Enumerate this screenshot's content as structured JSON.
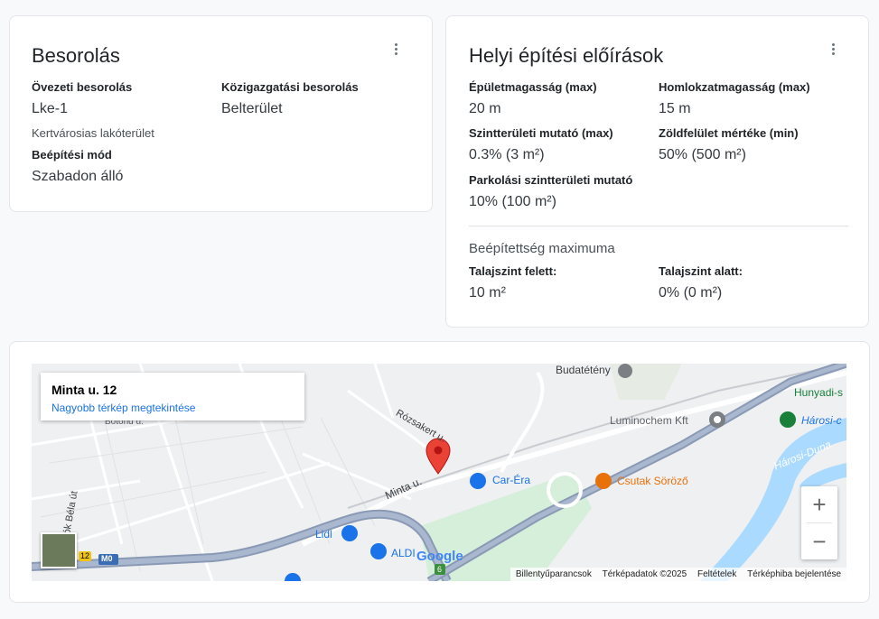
{
  "classification": {
    "title": "Besorolás",
    "zoning_label": "Övezeti besorolás",
    "zoning_value": "Lke-1",
    "zoning_desc": "Kertvárosias lakóterület",
    "admin_label": "Közigazgatási besorolás",
    "admin_value": "Belterület",
    "building_mode_label": "Beépítési mód",
    "building_mode_value": "Szabadon álló"
  },
  "regulations": {
    "title": "Helyi építési előírások",
    "building_height_label": "Épületmagasság (max)",
    "building_height_value": "20 m",
    "facade_height_label": "Homlokzatmagasság (max)",
    "facade_height_value": "15 m",
    "floor_ratio_label": "Szintterületi mutató (max)",
    "floor_ratio_value": "0.3% (3 m²)",
    "green_label": "Zöldfelület mértéke (min)",
    "green_value": "50% (500 m²)",
    "parking_label": "Parkolási szintterületi mutató",
    "parking_value": "10% (100 m²)",
    "coverage_title": "Beépítettség maximuma",
    "above_label": "Talajszint felett:",
    "above_value": "10 m²",
    "below_label": "Talajszint alatt:",
    "below_value": "0% (0 m²)"
  },
  "map": {
    "info_title": "Minta u. 12",
    "info_link": "Nagyobb térkép megtekintése",
    "labels": {
      "budatetenyi": "Budatétény",
      "hunyadi": "Hunyadi-s",
      "luminochem": "Luminochem Kft",
      "harosi_c": "Hárosi-c",
      "harosi_duna": "Hárosi-Duna",
      "rozsakert": "Rózsakert u.",
      "minta": "Minta u.",
      "carera": "Car-Éra",
      "csutak": "Csutak Söröző",
      "lidl": "Lidl",
      "aldi": "ALDI",
      "botond": "Botond u.",
      "bela": "rtók Béla út",
      "m0": "M0",
      "r12": "12",
      "r6": "6",
      "google": "Google"
    },
    "zoom_in": "+",
    "zoom_out": "−",
    "footer": {
      "shortcuts": "Billentyűparancsok",
      "mapdata": "Térképadatok ©2025",
      "terms": "Feltételek",
      "report": "Térképhiba bejelentése"
    }
  }
}
